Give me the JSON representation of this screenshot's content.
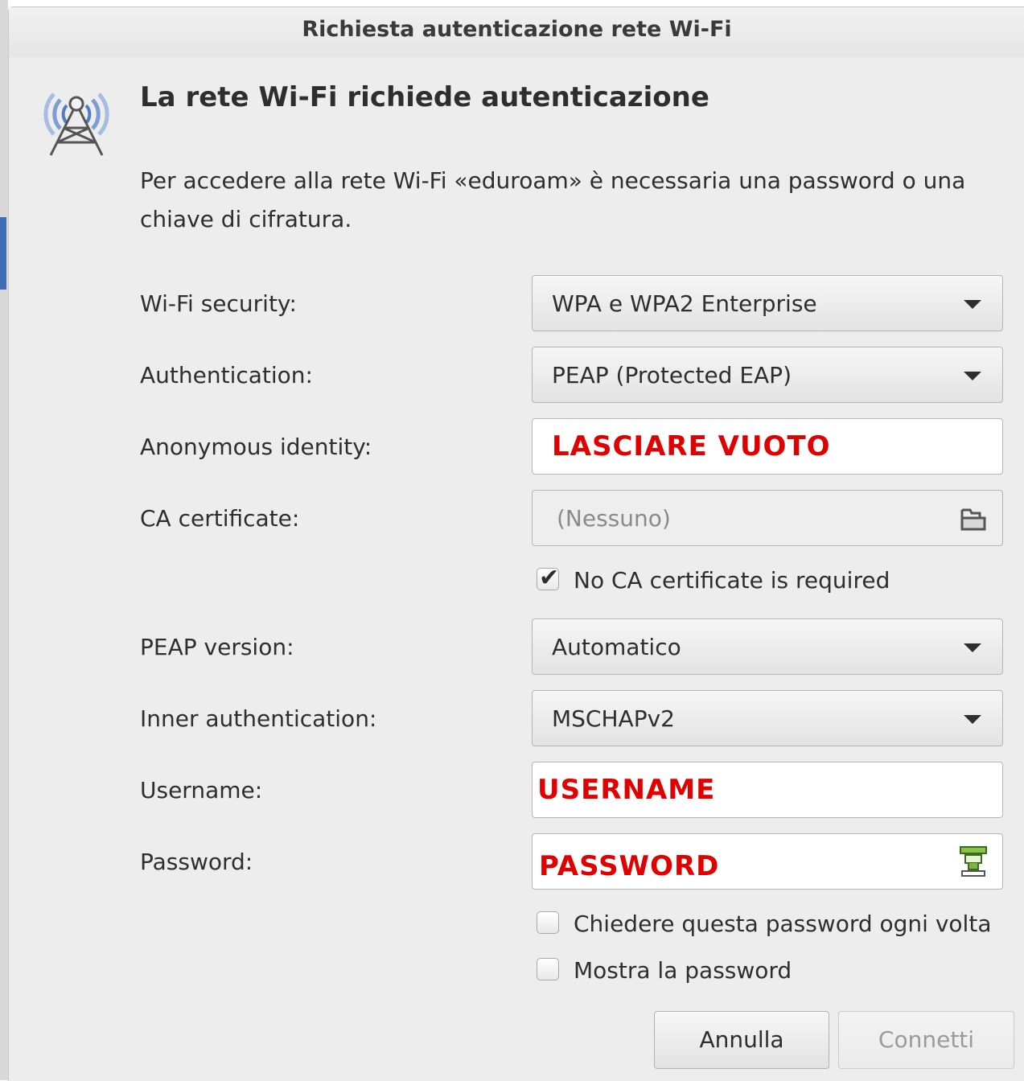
{
  "window": {
    "title": "Richiesta autenticazione rete Wi‑Fi"
  },
  "dialog": {
    "icon": "wifi-tower-icon",
    "heading": "La rete Wi‑Fi richiede autenticazione",
    "description": "Per accedere alla rete Wi-Fi «eduroam» è necessaria una password o una chiave di cifratura."
  },
  "form": {
    "wifi_security": {
      "label": "Wi-Fi security:",
      "value": "WPA e WPA2 Enterprise"
    },
    "authentication": {
      "label": "Authentication:",
      "value": "PEAP (Protected EAP)"
    },
    "anonymous_identity": {
      "label": "Anonymous identity:",
      "value": "LASCIARE VUOTO"
    },
    "ca_certificate": {
      "label": "CA certificate:",
      "value": "(Nessuno)",
      "icon": "file-chooser-icon"
    },
    "no_ca_required": {
      "label": "No CA certificate is required",
      "checked": true
    },
    "peap_version": {
      "label": "PEAP version:",
      "value": "Automatico"
    },
    "inner_authentication": {
      "label": "Inner authentication:",
      "value": "MSCHAPv2"
    },
    "username": {
      "label": "Username:",
      "value": "USERNAME"
    },
    "password": {
      "label": "Password:",
      "value": "PASSWORD",
      "icon": "password-storage-icon"
    },
    "ask_every_time": {
      "label": "Chiedere questa password ogni volta",
      "checked": false
    },
    "show_password": {
      "label": "Mostra la password",
      "checked": false
    }
  },
  "buttons": {
    "cancel": "Annulla",
    "connect": "Connetti"
  },
  "colors": {
    "annotation_red": "#e00000",
    "window_bg": "#ededed"
  }
}
